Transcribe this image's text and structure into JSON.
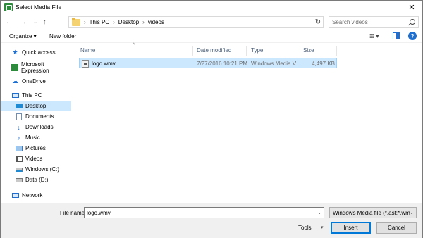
{
  "window": {
    "title": "Select Media File",
    "close_label": "✕"
  },
  "address": {
    "crumbs": [
      "This PC",
      "Desktop",
      "videos"
    ],
    "search_placeholder": "Search videos"
  },
  "toolbar": {
    "organize_label": "Organize ▾",
    "new_folder_label": "New folder",
    "help_label": "?"
  },
  "nav": {
    "items": [
      {
        "label": "Quick access",
        "icon": "star-icon"
      },
      {
        "label": "Microsoft Expression",
        "icon": "expression-icon"
      },
      {
        "label": "OneDrive",
        "icon": "cloud-icon"
      },
      {
        "label": "This PC",
        "icon": "computer-icon"
      },
      {
        "label": "Desktop",
        "icon": "desktop-icon",
        "selected": true
      },
      {
        "label": "Documents",
        "icon": "documents-icon"
      },
      {
        "label": "Downloads",
        "icon": "download-icon"
      },
      {
        "label": "Music",
        "icon": "music-icon"
      },
      {
        "label": "Pictures",
        "icon": "pictures-icon"
      },
      {
        "label": "Videos",
        "icon": "videos-icon"
      },
      {
        "label": "Windows (C:)",
        "icon": "drive-icon"
      },
      {
        "label": "Data (D:)",
        "icon": "drive-icon"
      },
      {
        "label": "Network",
        "icon": "network-icon"
      }
    ]
  },
  "columns": [
    "Name",
    "Date modified",
    "Type",
    "Size"
  ],
  "files": [
    {
      "name": "logo.wmv",
      "date": "7/27/2016 10:21 PM",
      "type": "Windows Media V...",
      "size": "4,497 KB"
    }
  ],
  "bottom": {
    "file_name_label": "File name:",
    "file_name_value": "logo.wmv",
    "filter_value": "Windows Media file (*.asf;*.wm",
    "tools_label": "Tools",
    "insert_label": "Insert",
    "cancel_label": "Cancel"
  },
  "colors": {
    "selection": "#cce8ff",
    "accent": "#0078d7"
  }
}
